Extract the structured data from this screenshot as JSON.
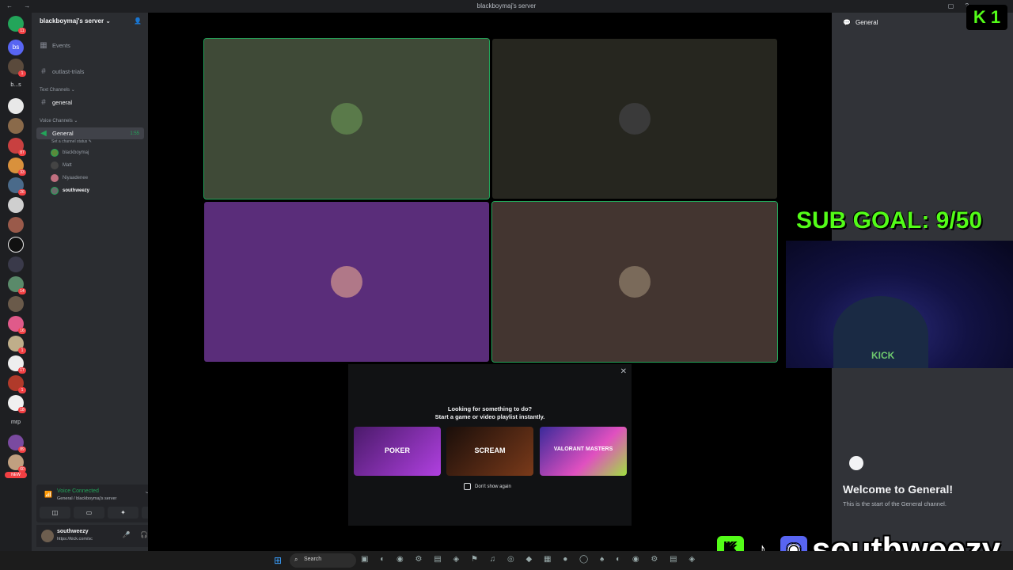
{
  "window": {
    "title": "blackboymaj's server"
  },
  "server": {
    "name": "blackboymaj's server ⌄"
  },
  "guild_texts": {
    "bs": "bs",
    "b_s": "b...s",
    "mrp": "mrp",
    "new": "NEW"
  },
  "channels": {
    "events": "Events",
    "outlast": "outlast-trials",
    "text_category": "Text Channels ⌄",
    "general_text": "general",
    "voice_category": "Voice Channels ⌄",
    "voice_general": "General",
    "voice_timer": "1:55",
    "channel_status": "Set a channel status ✎"
  },
  "voice_users": [
    "blackboymaj",
    "Matt",
    "Niyaadenee",
    "southweezy"
  ],
  "voice_panel": {
    "connected": "Voice Connected",
    "location": "General / blackboymaj's server"
  },
  "user": {
    "name": "southweezy",
    "status": "https://kick.com/sc"
  },
  "activity": {
    "line1": "Looking for something to do?",
    "line2": "Start a game or video playlist instantly.",
    "cards": [
      "POKER",
      "SCREAM",
      "VALORANT MASTERS"
    ],
    "dont_show": "Don't show again"
  },
  "chat": {
    "channel": "General",
    "welcome_title": "Welcome to General!",
    "welcome_sub": "This is the start of the General channel."
  },
  "stream": {
    "sub_goal": "SUB GOAL: 9/50",
    "kick_badge": "K 1",
    "brand": "southweezy",
    "shirt": "KICK"
  },
  "taskbar": {
    "search": "Search"
  },
  "colors": {
    "accent_green": "#23a55a",
    "kick_green": "#53fc18",
    "tile1": "#3f4a37",
    "tile2": "#26261f",
    "tile3": "#5a2d7a",
    "tile4": "#433530"
  }
}
